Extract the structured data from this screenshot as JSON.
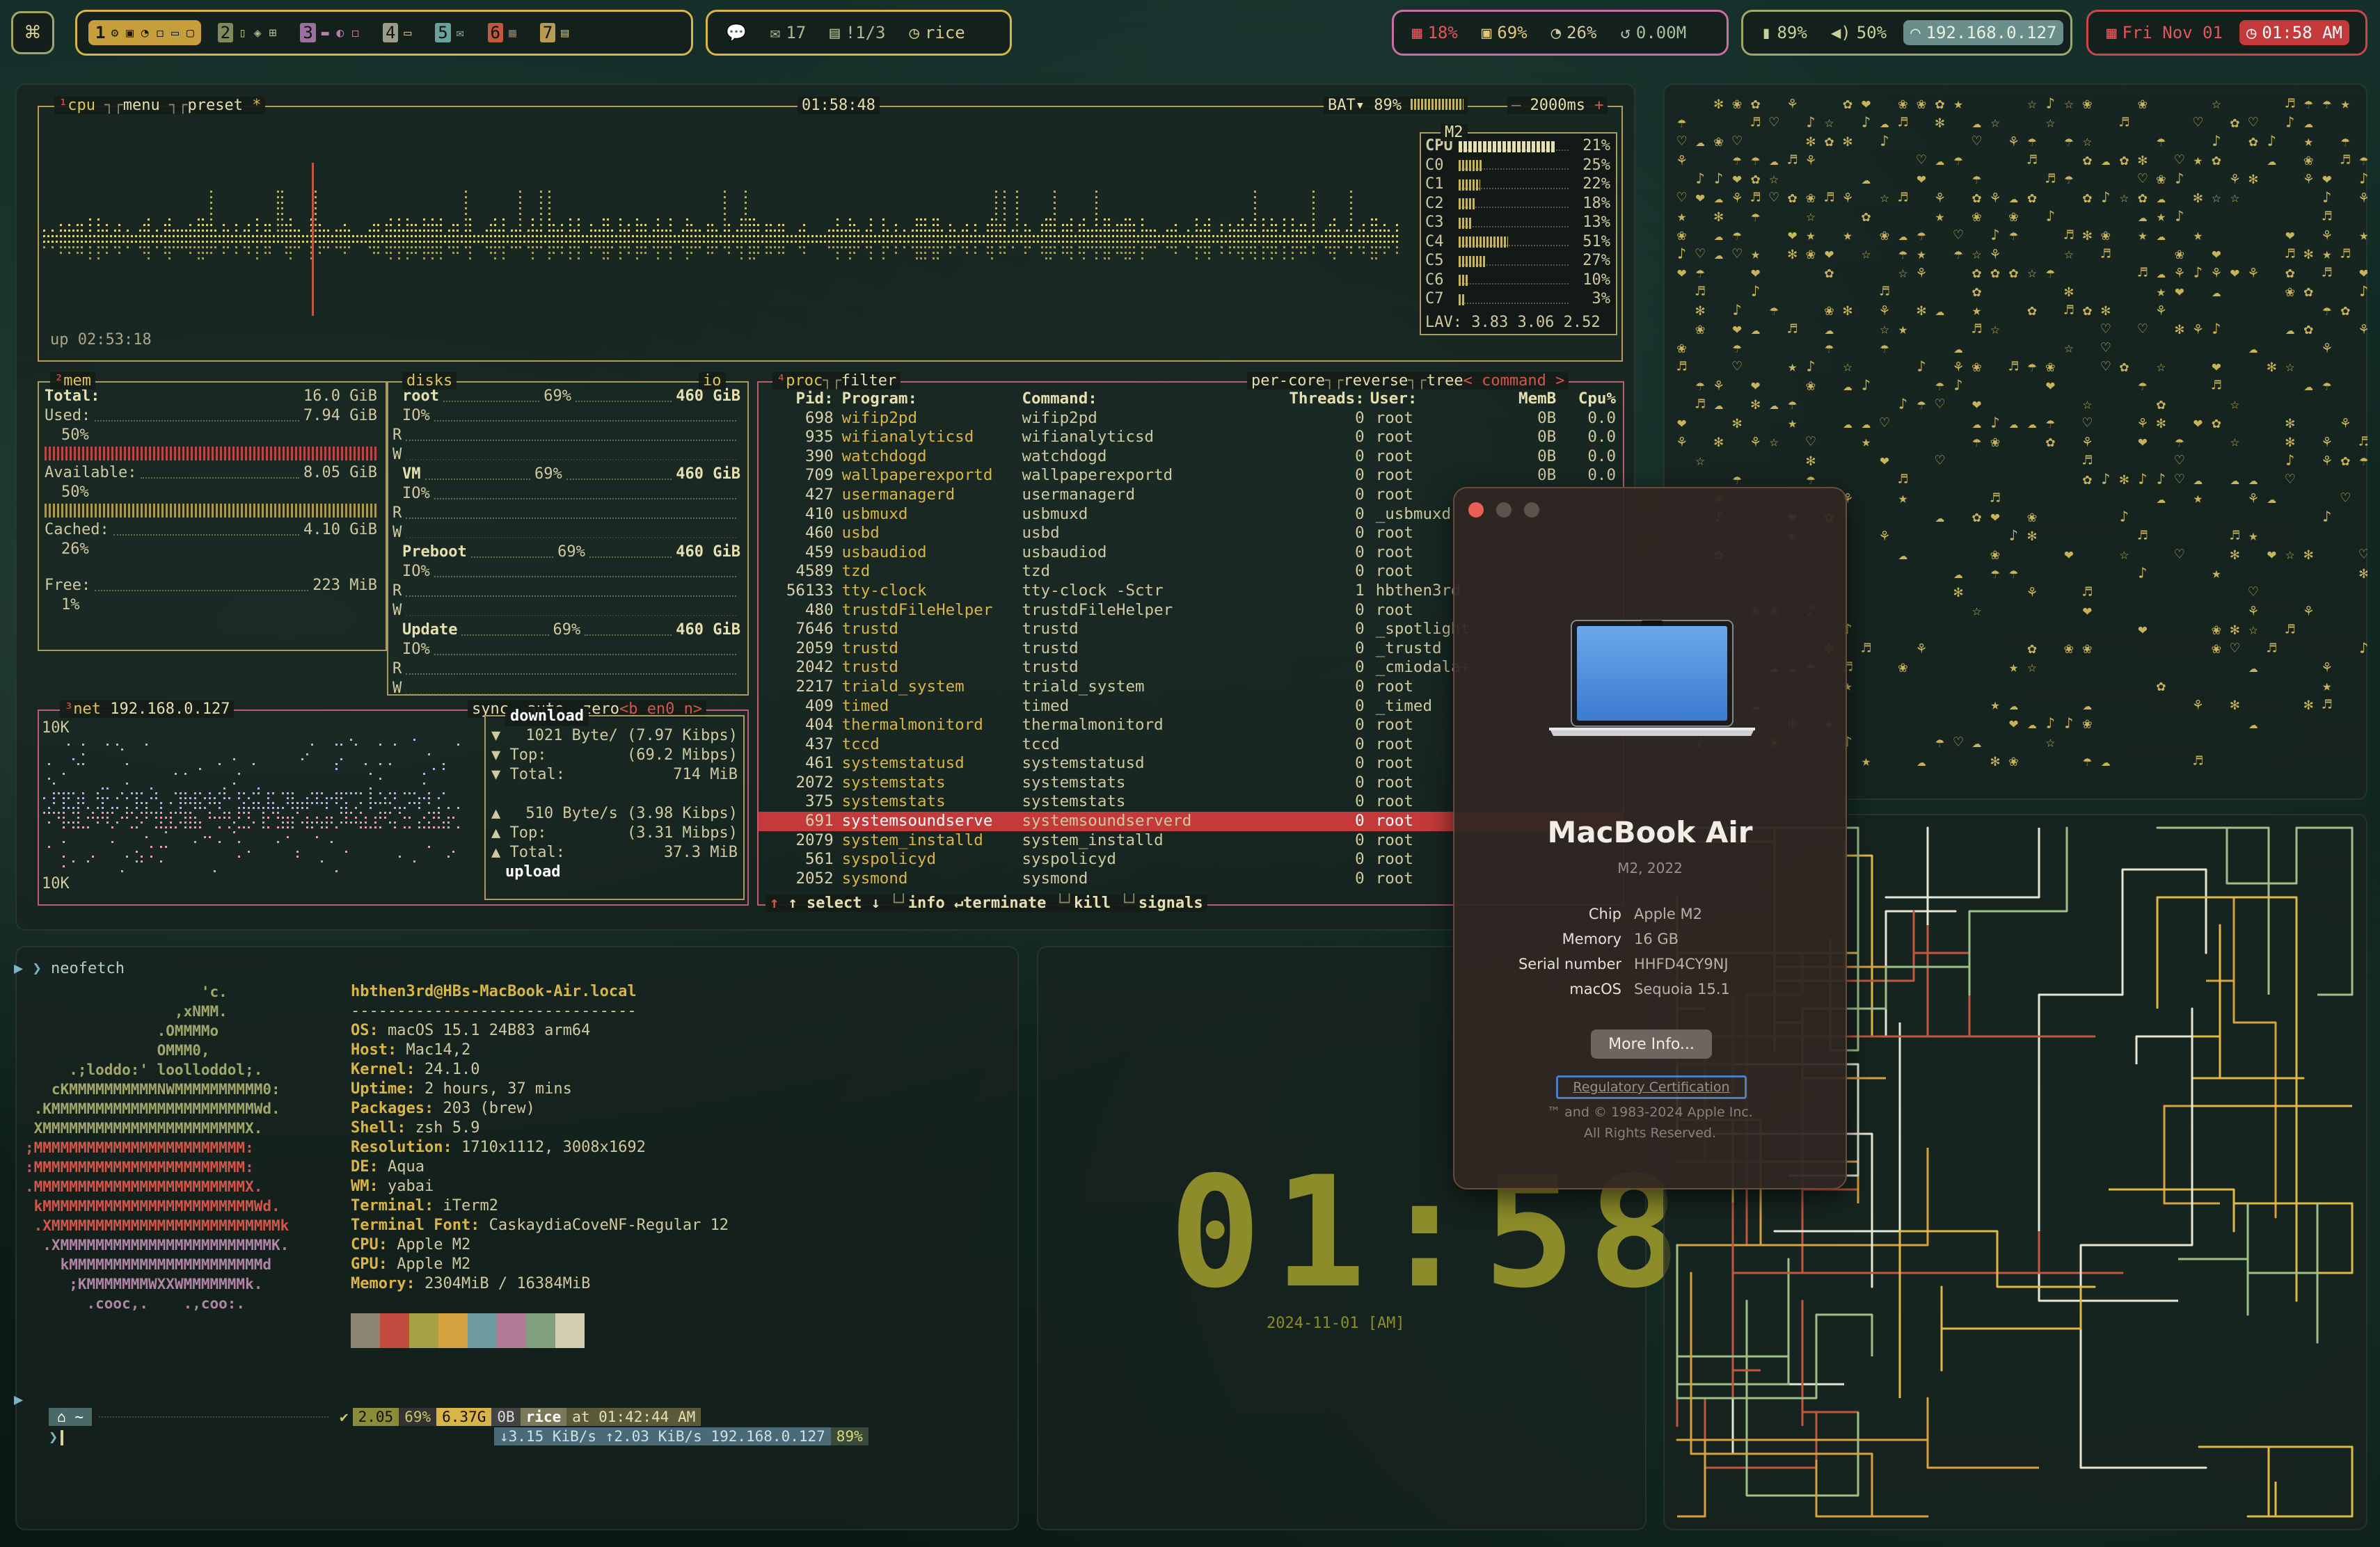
{
  "topbar": {
    "spaces": [
      {
        "num": "1",
        "icons": "⚙ ▣ ◔ ◻ ▭ ▢"
      },
      {
        "num": "2",
        "icons": "▯ ◈ ⊞"
      },
      {
        "num": "3",
        "icons": "▬ ◐ ◻"
      },
      {
        "num": "4",
        "icons": "▭"
      },
      {
        "num": "5",
        "icons": "✉"
      },
      {
        "num": "6",
        "icons": "▦"
      },
      {
        "num": "7",
        "icons": "▤"
      }
    ],
    "notifications": {
      "messages_icon": "💬",
      "mail_count": "17",
      "tasks": "!1/3",
      "workspace": "rice"
    },
    "stats": {
      "cpu": "18%",
      "memory": "69%",
      "disk": "26%",
      "network": "0.00M"
    },
    "system": {
      "battery": "89%",
      "volume": "50%",
      "ip": "192.168.0.127"
    },
    "datetime": {
      "date": "Fri Nov 01",
      "time": "01:58 AM"
    }
  },
  "btop": {
    "cpu": {
      "tabs": [
        "cpu",
        "menu",
        "preset"
      ],
      "clock": "01:58:48",
      "battery_label": "BAT▾ 89%",
      "interval": "2000ms",
      "uptime": "up 02:53:18",
      "chip": "M2",
      "cpu_total": {
        "label": "CPU",
        "value": "21%",
        "fraction": 0.21
      },
      "cores": [
        {
          "label": "C0",
          "value": "25%",
          "fraction": 0.25
        },
        {
          "label": "C1",
          "value": "22%",
          "fraction": 0.22
        },
        {
          "label": "C2",
          "value": "18%",
          "fraction": 0.18
        },
        {
          "label": "C3",
          "value": "13%",
          "fraction": 0.13
        },
        {
          "label": "C4",
          "value": "51%",
          "fraction": 0.51
        },
        {
          "label": "C5",
          "value": "27%",
          "fraction": 0.27
        },
        {
          "label": "C6",
          "value": "10%",
          "fraction": 0.1
        },
        {
          "label": "C7",
          "value": "3%",
          "fraction": 0.03
        }
      ],
      "load_avg": "LAV: 3.83 3.06 2.52"
    },
    "mem": {
      "title": "mem",
      "total_label": "Total:",
      "total": "16.0 GiB",
      "used_label": "Used:",
      "used": "7.94 GiB",
      "used_pct": "50%",
      "avail_label": "Available:",
      "avail": "8.05 GiB",
      "avail_pct": "50%",
      "cached_label": "Cached:",
      "cached": "4.10 GiB",
      "cached_pct": "26%",
      "free_label": "Free:",
      "free": "223 MiB",
      "free_pct": "1%"
    },
    "disks": {
      "title": "disks",
      "io_label": "io",
      "items": [
        {
          "name": "root",
          "pct": "69%",
          "size": "460 GiB"
        },
        {
          "name": "VM",
          "pct": "69%",
          "size": "460 GiB"
        },
        {
          "name": "Preboot",
          "pct": "69%",
          "size": "460 GiB"
        },
        {
          "name": "Update",
          "pct": "69%",
          "size": "460 GiB"
        }
      ],
      "io_text": "IO%",
      "r": "R",
      "w": "W"
    },
    "net": {
      "title": "net",
      "ip": "192.168.0.127",
      "tabs": [
        "sync",
        "auto",
        "zero",
        "<b en0 n>"
      ],
      "scale_top": "10K",
      "scale_bottom": "10K",
      "download_label": "download",
      "down_rate": "1021 Byte/ (7.97 Kibps)",
      "down_top_label": "Top:",
      "down_top": "(69.2 Mibps)",
      "down_total_label": "Total:",
      "down_total": "714 MiB",
      "up_rate": "510 Byte/s (3.98 Kibps)",
      "up_top_label": "Top:",
      "up_top": "(3.31 Mibps)",
      "up_total_label": "Total:",
      "up_total": "37.3 MiB",
      "upload_label": "upload"
    },
    "proc": {
      "title": "proc",
      "filter": "filter",
      "options": [
        "per-core",
        "reverse",
        "tree",
        "< command >"
      ],
      "headers": {
        "pid": "Pid:",
        "program": "Program:",
        "command": "Command:",
        "threads": "Threads:",
        "user": "User:",
        "memb": "MemB",
        "cpu": "Cpu%"
      },
      "rows": [
        [
          "698",
          "wifip2pd",
          "wifip2pd",
          "0",
          "root",
          "0B",
          "0.0"
        ],
        [
          "935",
          "wifianalyticsd",
          "wifianalyticsd",
          "0",
          "root",
          "0B",
          "0.0"
        ],
        [
          "390",
          "watchdogd",
          "watchdogd",
          "0",
          "root",
          "0B",
          "0.0"
        ],
        [
          "709",
          "wallpaperexportd",
          "wallpaperexportd",
          "0",
          "root",
          "0B",
          "0.0"
        ],
        [
          "427",
          "usermanagerd",
          "usermanagerd",
          "0",
          "root",
          "",
          ""
        ],
        [
          "410",
          "usbmuxd",
          "usbmuxd",
          "0",
          "_usbmuxd",
          "",
          ""
        ],
        [
          "460",
          "usbd",
          "usbd",
          "0",
          "root",
          "",
          ""
        ],
        [
          "459",
          "usbaudiod",
          "usbaudiod",
          "0",
          "root",
          "",
          ""
        ],
        [
          "4589",
          "tzd",
          "tzd",
          "0",
          "root",
          "",
          ""
        ],
        [
          "56133",
          "tty-clock",
          "tty-clock -Sctr",
          "1",
          "hbthen3rd",
          "",
          ""
        ],
        [
          "480",
          "trustdFileHelper",
          "trustdFileHelper",
          "0",
          "root",
          "",
          ""
        ],
        [
          "7646",
          "trustd",
          "trustd",
          "0",
          "_spotlight",
          "",
          ""
        ],
        [
          "2059",
          "trustd",
          "trustd",
          "0",
          "_trustd",
          "",
          ""
        ],
        [
          "2042",
          "trustd",
          "trustd",
          "0",
          "_cmiodala+",
          "",
          ""
        ],
        [
          "2217",
          "triald_system",
          "triald_system",
          "0",
          "root",
          "",
          ""
        ],
        [
          "409",
          "timed",
          "timed",
          "0",
          "_timed",
          "",
          ""
        ],
        [
          "404",
          "thermalmonitord",
          "thermalmonitord",
          "0",
          "root",
          "",
          ""
        ],
        [
          "437",
          "tccd",
          "tccd",
          "0",
          "root",
          "",
          ""
        ],
        [
          "461",
          "systemstatusd",
          "systemstatusd",
          "0",
          "root",
          "",
          ""
        ],
        [
          "2072",
          "systemstats",
          "systemstats",
          "0",
          "root",
          "",
          ""
        ],
        [
          "375",
          "systemstats",
          "systemstats",
          "0",
          "root",
          "",
          ""
        ],
        [
          "691",
          "systemsoundserve",
          "systemsoundserverd",
          "0",
          "root",
          "",
          ""
        ],
        [
          "2079",
          "system_installd",
          "system_installd",
          "0",
          "root",
          "",
          ""
        ],
        [
          "561",
          "syspolicyd",
          "syspolicyd",
          "0",
          "root",
          "",
          ""
        ],
        [
          "2052",
          "sysmond",
          "sysmond",
          "0",
          "root",
          "",
          ""
        ]
      ],
      "selected_index": 21,
      "footer": [
        "↑ select ↓",
        "info",
        "↵terminate",
        "kill",
        "signals"
      ]
    }
  },
  "neofetch": {
    "prompt": "neofetch",
    "user_host": "hbthen3rd@HBs-MacBook-Air.local",
    "separator": "-------------------------------",
    "fields": [
      {
        "k": "OS:",
        "v": "macOS 15.1 24B83 arm64"
      },
      {
        "k": "Host:",
        "v": "Mac14,2"
      },
      {
        "k": "Kernel:",
        "v": "24.1.0"
      },
      {
        "k": "Uptime:",
        "v": "2 hours, 37 mins"
      },
      {
        "k": "Packages:",
        "v": "203 (brew)"
      },
      {
        "k": "Shell:",
        "v": "zsh 5.9"
      },
      {
        "k": "Resolution:",
        "v": "1710x1112, 3008x1692"
      },
      {
        "k": "DE:",
        "v": "Aqua"
      },
      {
        "k": "WM:",
        "v": "yabai"
      },
      {
        "k": "Terminal:",
        "v": "iTerm2"
      },
      {
        "k": "Terminal Font:",
        "v": "CaskaydiaCoveNF-Regular 12"
      },
      {
        "k": "CPU:",
        "v": "Apple M2"
      },
      {
        "k": "GPU:",
        "v": "Apple M2"
      },
      {
        "k": "Memory:",
        "v": "2304MiB / 16384MiB"
      }
    ],
    "palette": [
      "#8d8572",
      "#c24a3e",
      "#a6a142",
      "#d3a33f",
      "#6f9aa0",
      "#b07a98",
      "#7fa07a",
      "#d3ccb0"
    ],
    "prompt_bar": {
      "home": "~",
      "load": "2.05",
      "mem": "69%",
      "disk": "6.37G",
      "zero": "0B",
      "rice": "rice",
      "time": "at 01:42:44 AM",
      "net": "↓3.15 KiB/s ↑2.03 KiB/s 192.168.0.127",
      "battery": "89%"
    }
  },
  "clock": {
    "time": "01:58",
    "date": "2024-11-01 [AM]"
  },
  "about": {
    "title": "MacBook Air",
    "subtitle": "M2, 2022",
    "specs": [
      {
        "k": "Chip",
        "v": "Apple M2"
      },
      {
        "k": "Memory",
        "v": "16 GB"
      },
      {
        "k": "Serial number",
        "v": "HHFD4CY9NJ"
      },
      {
        "k": "macOS",
        "v": "Sequoia 15.1"
      }
    ],
    "more_info": "More Info...",
    "regulatory": "Regulatory Certification",
    "copyright1": "™ and © 1983-2024 Apple Inc.",
    "copyright2": "All Rights Reserved."
  }
}
